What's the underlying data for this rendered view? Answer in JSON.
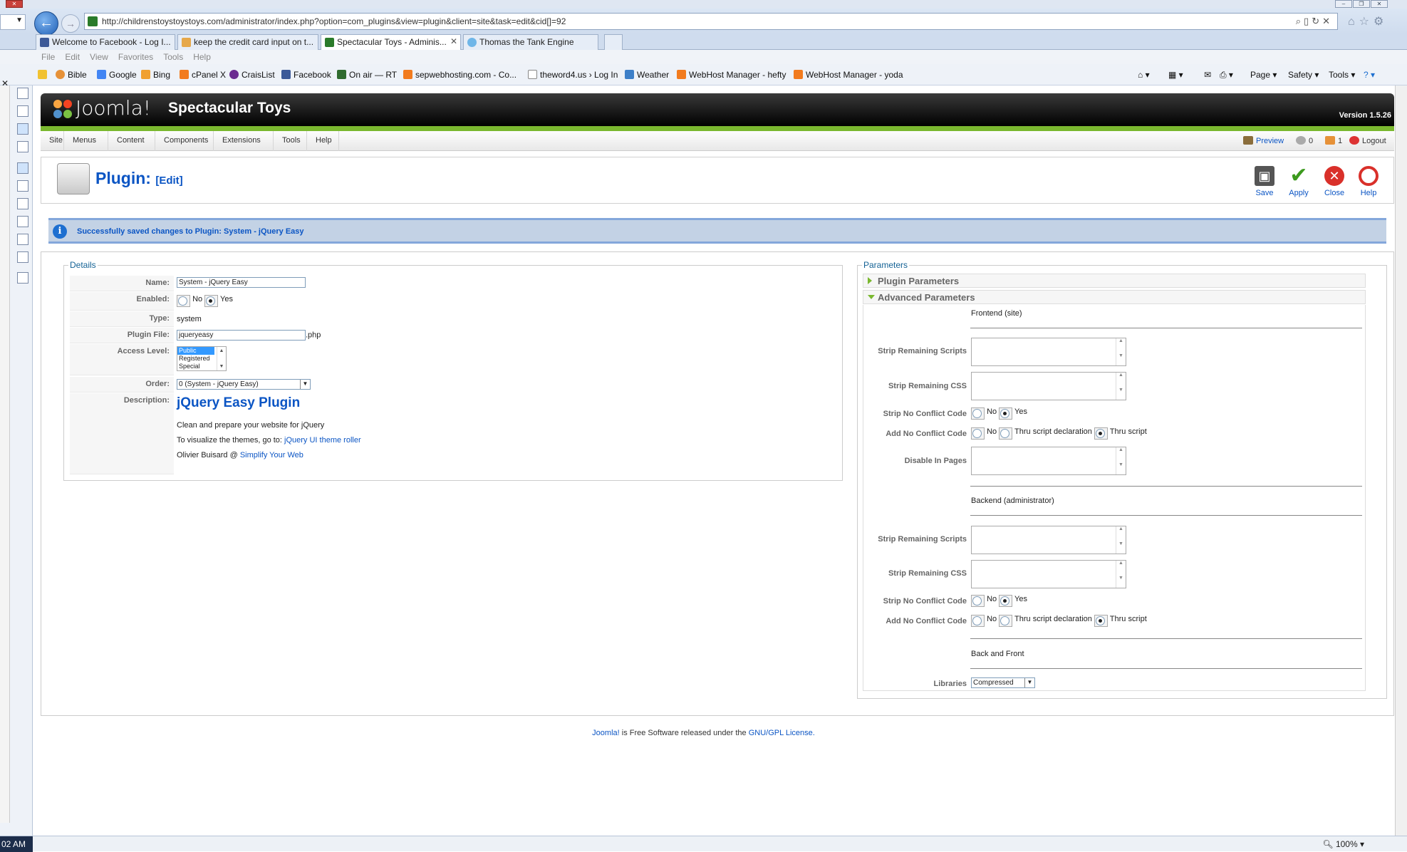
{
  "browser": {
    "url_prefix": "http://childrenstoystoystoys.com",
    "url_rest": "/administrator/index.php?option=com_plugins&view=plugin&client=site&task=edit&cid[]=92",
    "tabs": [
      {
        "label": "Welcome to Facebook - Log I..."
      },
      {
        "label": "keep the credit card input on t..."
      },
      {
        "label": "Spectacular Toys - Adminis...",
        "active": true
      },
      {
        "label": "Thomas the Tank Engine"
      }
    ],
    "menu": [
      "File",
      "Edit",
      "View",
      "Favorites",
      "Tools",
      "Help"
    ],
    "favorites": [
      "Bible",
      "Google",
      "Bing",
      "cPanel X",
      "CraisList",
      "Facebook",
      "On air — RT",
      "sepwebhosting.com - Co...",
      "theword4.us › Log In",
      "Weather",
      "WebHost Manager - hefty",
      "WebHost Manager - yoda"
    ],
    "commandbar": [
      "Page",
      "Safety",
      "Tools"
    ],
    "clock": "02 AM",
    "zoom": "100%"
  },
  "joomla": {
    "logo_text": "Joomla!",
    "site_name": "Spectacular Toys",
    "version": "Version 1.5.26",
    "menu": [
      "Site",
      "Menus",
      "Content",
      "Components",
      "Extensions",
      "Tools",
      "Help"
    ],
    "status": {
      "preview": "Preview",
      "messages": "0",
      "users": "1",
      "logout": "Logout"
    },
    "page_title": "Plugin:",
    "page_subtitle": "[Edit]",
    "toolbar": {
      "save": "Save",
      "apply": "Apply",
      "close": "Close",
      "help": "Help"
    },
    "message": "Successfully saved changes to Plugin: System - jQuery Easy"
  },
  "details": {
    "legend": "Details",
    "name_label": "Name:",
    "name_value": "System - jQuery Easy",
    "enabled_label": "Enabled:",
    "no": "No",
    "yes": "Yes",
    "type_label": "Type:",
    "type_value": "system",
    "file_label": "Plugin File:",
    "file_value": "jqueryeasy",
    "file_ext": ".php",
    "access_label": "Access Level:",
    "access_options": [
      "Public",
      "Registered",
      "Special"
    ],
    "order_label": "Order:",
    "order_value": "0 (System - jQuery Easy)",
    "description_label": "Description:",
    "desc_title": "jQuery Easy Plugin",
    "desc_line1": "Clean and prepare your website for jQuery",
    "desc_line2_prefix": "To visualize the themes, go to:",
    "desc_line2_link": "jQuery UI theme roller",
    "desc_line3_prefix": "Olivier Buisard @",
    "desc_line3_link": "Simplify Your Web"
  },
  "params": {
    "legend": "Parameters",
    "plugin_params": "Plugin Parameters",
    "advanced_params": "Advanced Parameters",
    "frontend": "Frontend (site)",
    "backend": "Backend (administrator)",
    "back_and_front": "Back and Front",
    "strip_scripts": "Strip Remaining Scripts",
    "strip_css": "Strip Remaining CSS",
    "strip_noconflict": "Strip No Conflict Code",
    "add_noconflict": "Add No Conflict Code",
    "disable_pages": "Disable In Pages",
    "no": "No",
    "yes": "Yes",
    "thru_decl": "Thru script declaration",
    "thru_script": "Thru script",
    "libraries": "Libraries",
    "libraries_value": "Compressed"
  },
  "footer": {
    "joomla_link": "Joomla!",
    "text": " is Free Software released under the ",
    "license_link": "GNU/GPL License."
  }
}
